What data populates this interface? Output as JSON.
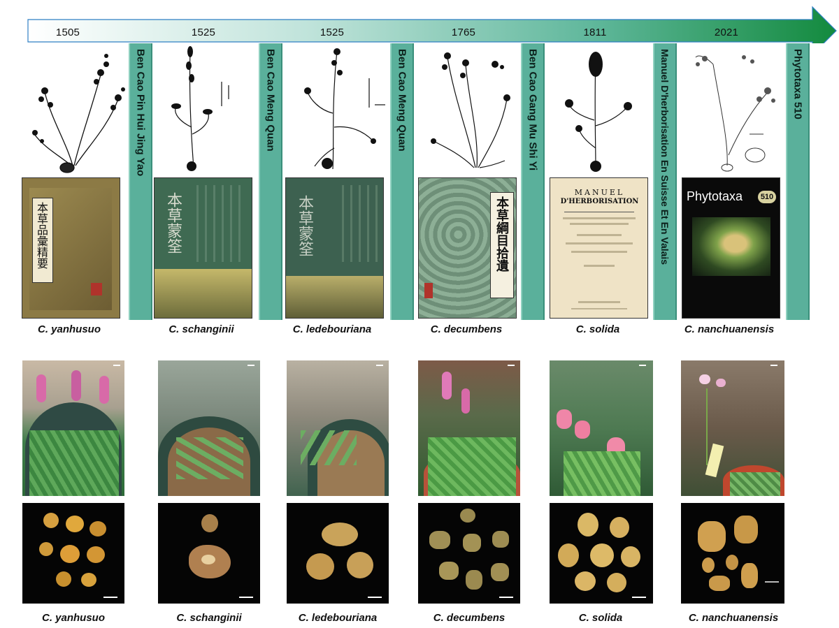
{
  "timeline": {
    "years": [
      "1505",
      "1525",
      "1525",
      "1765",
      "1811",
      "2021"
    ],
    "colors": {
      "start": "#ffffff",
      "mid": "#9fd3c3",
      "end": "#138a3e",
      "border": "#2f7fc4"
    }
  },
  "books": [
    {
      "title": "Ben Cao Pin Hui Jing Yao"
    },
    {
      "title": "Ben Cao Meng Quan"
    },
    {
      "title": "Ben Cao Meng Quan"
    },
    {
      "title": "Ben Cao Gang Mu Shi Yi"
    },
    {
      "title": "Manuel D'herborisation En Suisse Et En Valais"
    },
    {
      "title": "Phytotaxa 510"
    }
  ],
  "covers": {
    "c1": "本草品彙精要",
    "c2": "本草蒙筌",
    "c3": "本草蒙筌",
    "c4": "本草綱目拾遺",
    "c5": {
      "line1": "MANUEL",
      "line2": "D'HERBORISATION"
    },
    "c6": {
      "journal": "Phytotaxa",
      "issue": "510"
    }
  },
  "species": [
    "C. yanhusuo",
    "C. schanginii",
    "C. ledebouriana",
    "C. decumbens",
    "C. solida",
    "C. nanchuanensis"
  ],
  "colors": {
    "bar": "#5ab09b",
    "cover_gold": "#8c7a45",
    "cover_green": "#3f6a52",
    "cover_paper": "#efe3c6",
    "cover_black": "#0a0a0a",
    "flower_pink": "#d86aa8"
  }
}
